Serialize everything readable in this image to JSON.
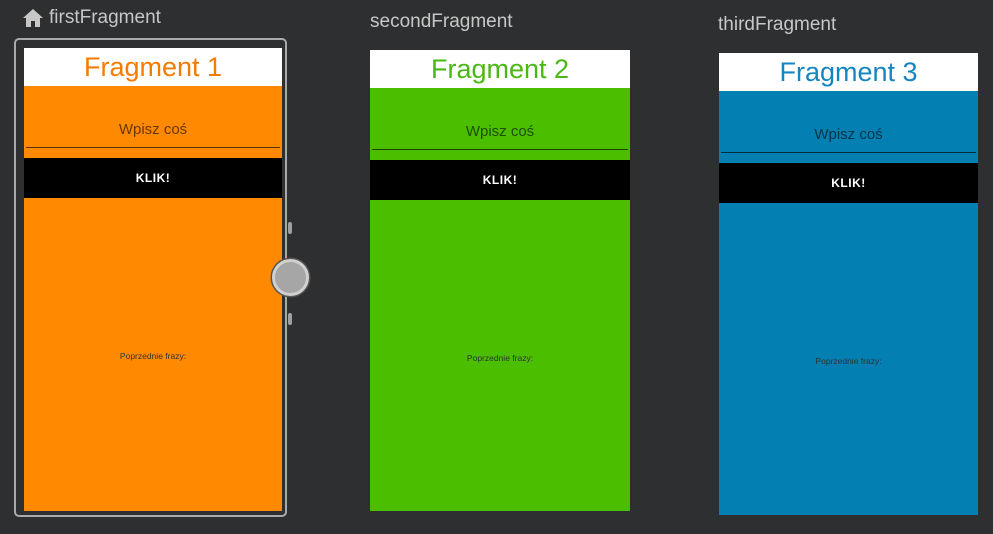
{
  "colors": {
    "canvas_bg": "#2e2f30",
    "label_text": "#c7c7c7",
    "selection_frame": "#a9a9a9"
  },
  "destinations": [
    {
      "label": "firstFragment",
      "is_start": true,
      "title": "Fragment 1",
      "title_color": "#f47b00",
      "bg_color": "#ff8900",
      "input_placeholder": "Wpisz coś",
      "button_label": "KLIK!",
      "previous_label": "Poprzednie frazy:"
    },
    {
      "label": "secondFragment",
      "is_start": false,
      "title": "Fragment 2",
      "title_color": "#4ab814",
      "bg_color": "#4bbe00",
      "input_placeholder": "Wpisz coś",
      "button_label": "KLIK!",
      "previous_label": "Poprzednie frazy:"
    },
    {
      "label": "thirdFragment",
      "is_start": false,
      "title": "Fragment 3",
      "title_color": "#1485be",
      "bg_color": "#047fb2",
      "input_placeholder": "Wpisz coś",
      "button_label": "KLIK!",
      "previous_label": "Poprzednie frazy:"
    }
  ]
}
